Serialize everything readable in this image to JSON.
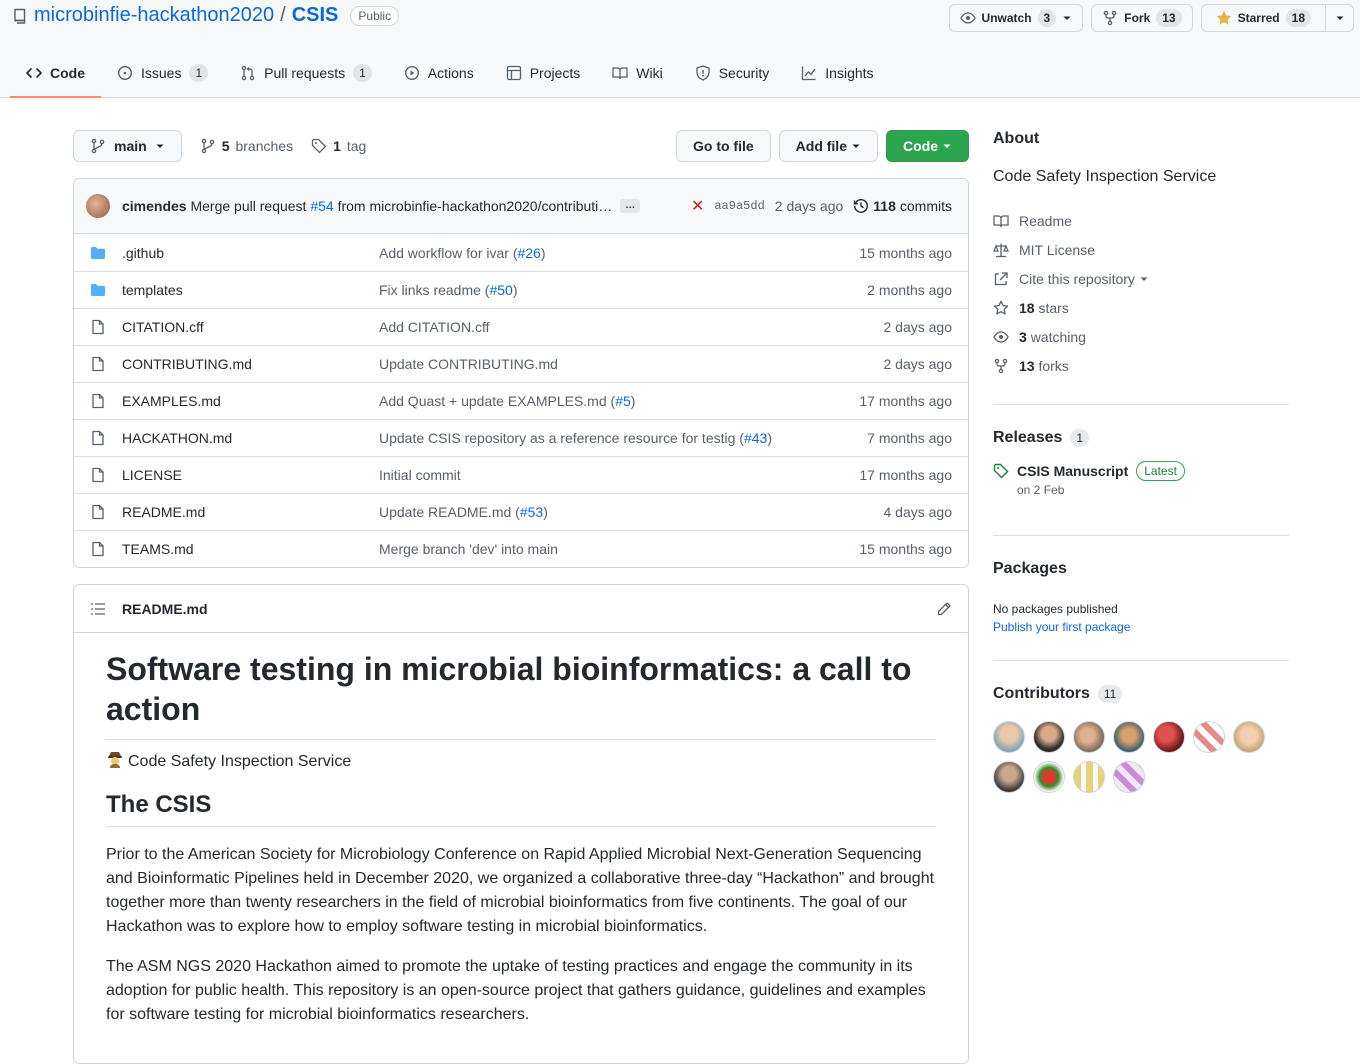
{
  "header": {
    "owner": "microbinfie-hackathon2020",
    "separator": "/",
    "repo": "CSIS",
    "visibility": "Public",
    "watch": {
      "label": "Unwatch",
      "count": "3"
    },
    "fork": {
      "label": "Fork",
      "count": "13"
    },
    "star": {
      "label": "Starred",
      "count": "18"
    }
  },
  "nav": {
    "code": "Code",
    "issues": "Issues",
    "issues_count": "1",
    "pulls": "Pull requests",
    "pulls_count": "1",
    "actions": "Actions",
    "projects": "Projects",
    "wiki": "Wiki",
    "security": "Security",
    "insights": "Insights"
  },
  "toolbar": {
    "branch": "main",
    "branches_count": "5",
    "branches_label": "branches",
    "tags_count": "1",
    "tags_label": "tag",
    "go_to_file": "Go to file",
    "add_file": "Add file",
    "code_button": "Code"
  },
  "latest_commit": {
    "author": "cimendes",
    "message_prefix": "Merge pull request",
    "pr": "#54",
    "message_suffix": "from microbinfie-hackathon2020/contributi…",
    "ellipsis": "…",
    "sha": "aa9a5dd",
    "age": "2 days ago",
    "commits_count": "118",
    "commits_label": "commits"
  },
  "files": [
    {
      "type": "dir",
      "name": ".github",
      "msg": "Add workflow for ivar (",
      "pr": "#26",
      "msg_end": ")",
      "age": "15 months ago"
    },
    {
      "type": "dir",
      "name": "templates",
      "msg": "Fix links readme (",
      "pr": "#50",
      "msg_end": ")",
      "age": "2 months ago"
    },
    {
      "type": "file",
      "name": "CITATION.cff",
      "msg": "Add CITATION.cff",
      "pr": "",
      "msg_end": "",
      "age": "2 days ago"
    },
    {
      "type": "file",
      "name": "CONTRIBUTING.md",
      "msg": "Update CONTRIBUTING.md",
      "pr": "",
      "msg_end": "",
      "age": "2 days ago"
    },
    {
      "type": "file",
      "name": "EXAMPLES.md",
      "msg": "Add Quast + update EXAMPLES.md (",
      "pr": "#5",
      "msg_end": ")",
      "age": "17 months ago"
    },
    {
      "type": "file",
      "name": "HACKATHON.md",
      "msg": "Update CSIS repository as a reference resource for testig (",
      "pr": "#43",
      "msg_end": ")",
      "age": "7 months ago"
    },
    {
      "type": "file",
      "name": "LICENSE",
      "msg": "Initial commit",
      "pr": "",
      "msg_end": "",
      "age": "17 months ago"
    },
    {
      "type": "file",
      "name": "README.md",
      "msg": "Update README.md (",
      "pr": "#53",
      "msg_end": ")",
      "age": "4 days ago"
    },
    {
      "type": "file",
      "name": "TEAMS.md",
      "msg": "Merge branch 'dev' into main",
      "pr": "",
      "msg_end": "",
      "age": "15 months ago"
    }
  ],
  "readme": {
    "filename": "README.md",
    "h1": "Software testing in microbial bioinformatics: a call to action",
    "tagline": "Code Safety Inspection Service",
    "h2": "The CSIS",
    "p1": "Prior to the American Society for Microbiology Conference on Rapid Applied Microbial Next-Generation Sequencing and Bioinformatic Pipelines held in December 2020, we organized a collaborative three-day “Hackathon” and brought together more than twenty researchers in the field of microbial bioinformatics from five continents. The goal of our Hackathon was to explore how to employ software testing in microbial bioinformatics.",
    "p2": "The ASM NGS 2020 Hackathon aimed to promote the uptake of testing practices and engage the community in its adoption for public health. This repository is an open-source project that gathers guidance, guidelines and examples for software testing for microbial bioinformatics researchers."
  },
  "sidebar": {
    "about_title": "About",
    "description": "Code Safety Inspection Service",
    "readme": "Readme",
    "license": "MIT License",
    "cite": "Cite this repository",
    "stars_count": "18",
    "stars_label": "stars",
    "watching_count": "3",
    "watching_label": "watching",
    "forks_count": "13",
    "forks_label": "forks",
    "releases_title": "Releases",
    "releases_count": "1",
    "release_name": "CSIS Manuscript",
    "release_badge": "Latest",
    "release_date": "on 2 Feb",
    "packages_title": "Packages",
    "packages_none": "No packages published",
    "packages_link": "Publish your first package",
    "contributors_title": "Contributors",
    "contributors_count": "11"
  },
  "colors": {
    "accent": "#0969da",
    "green": "#2da44e",
    "danger": "#cf222e",
    "nav_underline": "#fd8c73",
    "folder": "#54aeff"
  }
}
